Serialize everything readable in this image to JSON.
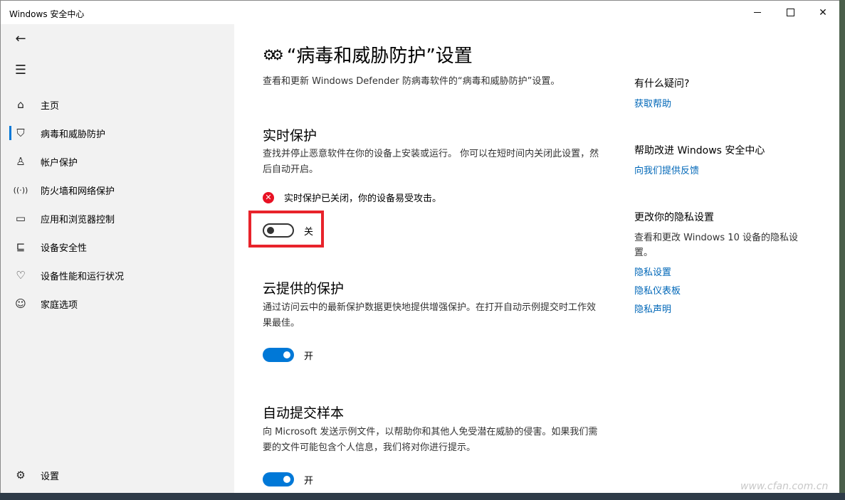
{
  "window": {
    "title": "Windows 安全中心"
  },
  "sidebar": {
    "items": [
      {
        "label": "主页",
        "icon": "home-icon"
      },
      {
        "label": "病毒和威胁防护",
        "icon": "shield-icon"
      },
      {
        "label": "帐户保护",
        "icon": "person-icon"
      },
      {
        "label": "防火墙和网络保护",
        "icon": "wifi-signal-icon"
      },
      {
        "label": "应用和浏览器控制",
        "icon": "browser-window-icon"
      },
      {
        "label": "设备安全性",
        "icon": "laptop-icon"
      },
      {
        "label": "设备性能和运行状况",
        "icon": "heart-pulse-icon"
      },
      {
        "label": "家庭选项",
        "icon": "family-icon"
      }
    ],
    "settings_label": "设置"
  },
  "main": {
    "title": "“病毒和威胁防护”设置",
    "subtitle": "查看和更新 Windows Defender 防病毒软件的“病毒和威胁防护”设置。",
    "realtime": {
      "heading": "实时保护",
      "desc": "查找并停止恶意软件在你的设备上安装或运行。 你可以在短时间内关闭此设置，然后自动开启。",
      "warning": "实时保护已关闭，你的设备易受攻击。",
      "toggle_state": "关",
      "toggle_on": false
    },
    "cloud": {
      "heading": "云提供的保护",
      "desc": "通过访问云中的最新保护数据更快地提供增强保护。在打开自动示例提交时工作效果最佳。",
      "toggle_state": "开",
      "toggle_on": true
    },
    "sample": {
      "heading": "自动提交样本",
      "desc": "向 Microsoft 发送示例文件，以帮助你和其他人免受潜在威胁的侵害。如果我们需要的文件可能包含个人信息，我们将对你进行提示。",
      "toggle_state": "开",
      "toggle_on": true
    }
  },
  "right": {
    "help_heading": "有什么疑问?",
    "help_link": "获取帮助",
    "improve_heading": "帮助改进 Windows 安全中心",
    "improve_link": "向我们提供反馈",
    "privacy_heading": "更改你的隐私设置",
    "privacy_text": "查看和更改 Windows 10 设备的隐私设置。",
    "privacy_links": [
      "隐私设置",
      "隐私仪表板",
      "隐私声明"
    ]
  },
  "colors": {
    "accent": "#0078d7",
    "link": "#0067b8",
    "alert": "#e81123",
    "highlight": "#e8232b"
  },
  "watermark": "www.cfan.com.cn"
}
